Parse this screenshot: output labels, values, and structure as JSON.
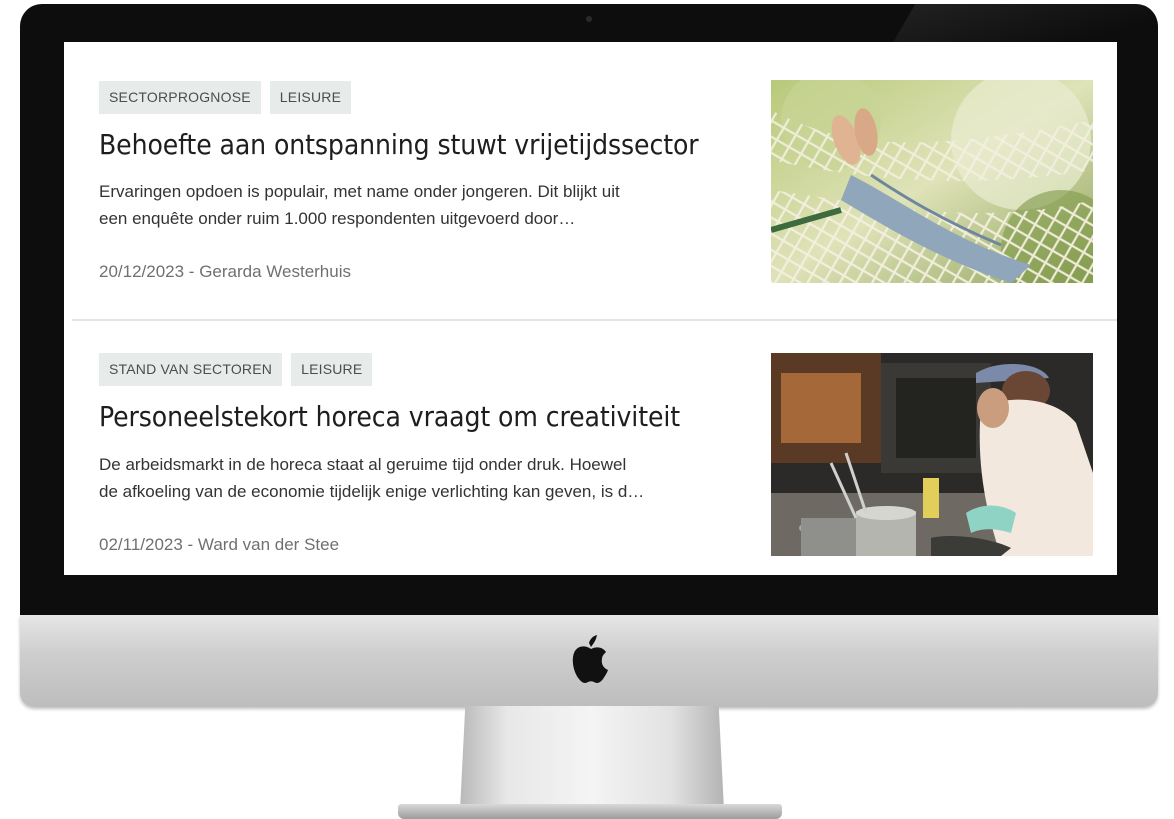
{
  "articles": [
    {
      "tags": [
        "SECTORPROGNOSE",
        "LEISURE"
      ],
      "title": "Behoefte aan ontspanning stuwt vrijetijdssector",
      "excerpt_line1": "Ervaringen opdoen is populair, met name onder jongeren. Dit blijkt uit",
      "excerpt_line2": "een enquête onder ruim 1.000 respondenten uitgevoerd door…",
      "meta": "20/12/2023 - Gerarda Westerhuis",
      "image": "hammock-photo"
    },
    {
      "tags": [
        "STAND VAN SECTOREN",
        "LEISURE"
      ],
      "title": "Personeelstekort horeca vraagt om creativiteit",
      "excerpt_line1": "De arbeidsmarkt in de horeca staat al geruime tijd onder druk. Hoewel",
      "excerpt_line2": "de afkoeling van de economie tijdelijk enige verlichting kan geven, is d…",
      "meta": "02/11/2023 - Ward van der Stee",
      "image": "kitchen-chef-photo"
    }
  ],
  "colors": {
    "tag_bg": "#e7ebea",
    "title": "#1e1e1e",
    "meta": "#707070",
    "bezel": "#0d0d0d"
  },
  "icons": {
    "brand_logo": "apple-logo-icon"
  }
}
